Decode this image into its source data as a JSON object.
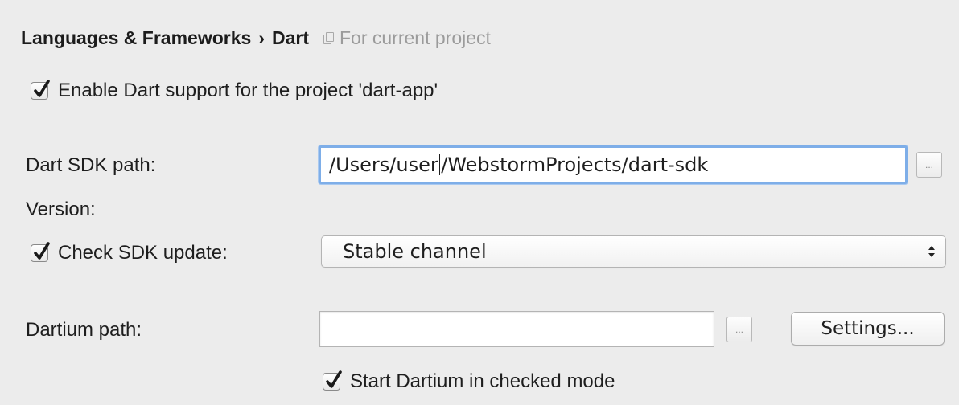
{
  "header": {
    "breadcrumb": [
      "Languages & Frameworks",
      "Dart"
    ],
    "separator": "›",
    "scope_icon": "copy-scope-icon",
    "scope_label": "For current project"
  },
  "enable_dart": {
    "label": "Enable Dart support for the project 'dart-app'",
    "checked": true
  },
  "sdk_path": {
    "label": "Dart SDK path:",
    "value_before_caret": "/Users/user",
    "value_after_caret": "/WebstormProjects/dart-sdk",
    "browse_label": "..."
  },
  "version": {
    "label": "Version:"
  },
  "check_update": {
    "label": "Check SDK update:",
    "checked": true,
    "selected_option": "Stable channel"
  },
  "dartium": {
    "label": "Dartium path:",
    "value": "",
    "browse_label": "...",
    "settings_label": "Settings..."
  },
  "checked_mode": {
    "label": "Start Dartium in checked mode",
    "checked": true
  },
  "colors": {
    "background": "#ececec",
    "focus_ring": "#7eaee8",
    "checkmark": "#1a1a1a"
  }
}
